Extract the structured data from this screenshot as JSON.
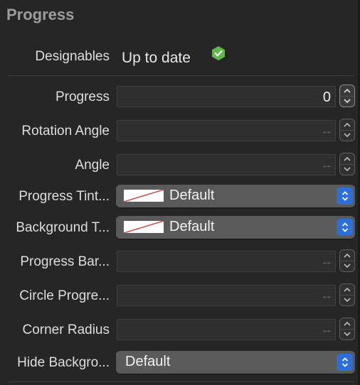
{
  "section": {
    "title": "Progress"
  },
  "designables": {
    "label": "Designables",
    "status": "Up to date",
    "status_color": "#5cba47"
  },
  "rows": {
    "progress": {
      "label": "Progress",
      "value": "0"
    },
    "rotation_angle": {
      "label": "Rotation Angle",
      "value": "--"
    },
    "angle": {
      "label": "Angle",
      "value": "--"
    },
    "progress_tint": {
      "label": "Progress Tint...",
      "value": "Default"
    },
    "background_tint": {
      "label": "Background T...",
      "value": "Default"
    },
    "progress_bar": {
      "label": "Progress Bar...",
      "value": "--"
    },
    "circle_progress": {
      "label": "Circle Progre...",
      "value": "--"
    },
    "corner_radius": {
      "label": "Corner Radius",
      "value": "--"
    },
    "hide_background": {
      "label": "Hide Backgro...",
      "value": "Default"
    }
  },
  "colors": {
    "accent": "#2b6fd8",
    "panel_bg": "#262626",
    "no_color_slash": "#d0413a"
  }
}
